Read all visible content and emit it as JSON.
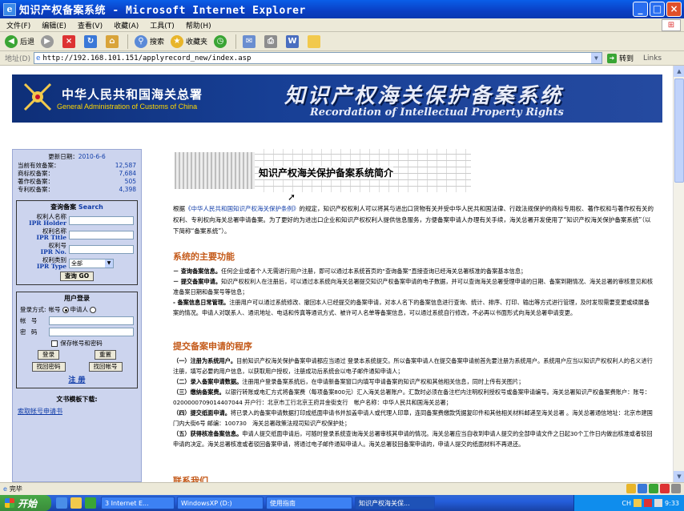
{
  "window": {
    "title": "知识产权备案系统 - Microsoft Internet Explorer"
  },
  "menu": [
    "文件(F)",
    "编辑(E)",
    "查看(V)",
    "收藏(A)",
    "工具(T)",
    "帮助(H)"
  ],
  "toolbar": {
    "back": "后退",
    "search": "搜索",
    "favorites": "收藏夹"
  },
  "address": {
    "label": "地址(D)",
    "url": "http://192.168.101.151/applyrecord_new/index.asp",
    "go": "转到",
    "links": "Links"
  },
  "banner": {
    "org_cn": "中华人民共和国海关总署",
    "org_en": "General Administration of Customs of China",
    "system_cn": "知识产权海关保护备案系统",
    "system_en": "Recordation of Intellectual Property Rights"
  },
  "stats": {
    "update_label": "更新日期：",
    "update_date": "2010-6-6",
    "rows": [
      {
        "label": "当前有效备案：",
        "value": "12,587"
      },
      {
        "label": "商标权备案：",
        "value": "7,684"
      },
      {
        "label": "著作权备案：",
        "value": "505"
      },
      {
        "label": "专利权备案：",
        "value": "4,398"
      }
    ]
  },
  "search": {
    "title_cn": "查询备案",
    "title_en": "Search",
    "holder_cn": "权利人名称",
    "holder_en": "IPR Holder",
    "title_field_cn": "权利名称",
    "title_field_en": "IPR Title",
    "no_cn": "权利号",
    "no_en": "IPR No.",
    "type_cn": "权利类别",
    "type_en": "IPR Type",
    "type_value": "全部",
    "button": "查询 GO"
  },
  "login": {
    "title": "用户登录",
    "mode_label": "登录方式:",
    "mode_account": "帐号",
    "mode_applicant": "申请人",
    "account_label": "帐 号",
    "password_label": "密 码",
    "remember": "保存帐号和密码",
    "login_btn": "登录",
    "reset_btn": "重置",
    "find_pwd": "找回密码",
    "find_acc": "找回帐号",
    "register": "注 册"
  },
  "downloads": {
    "title": "文书模板下载:",
    "link1": "索取帐号申请书"
  },
  "intro": {
    "image_title": "知识产权海关保护备案系统简介",
    "p1_pre": "根据",
    "p1_link": "《中华人民共和国知识产权海关保护条例》",
    "p1_post": "的规定，知识产权权利人可以将其与进出口货物有关并受中华人民共和国法律、行政法规保护的商标专用权、著作权和与著作权有关的权利、专利权向海关总署申请备案。为了更好的为进出口企业和知识产权权利人提供信息服务，方便备案申请人办理有关手续，海关总署开发使用了“知识产权海关保护备案系统”（以下简称“备案系统”）。"
  },
  "functions": {
    "heading": "系统的主要功能",
    "f1_title": "－ 查询备案信息。",
    "f1_text": "任何企业或者个人无需进行用户注册，即可以通过本系统首页的“查询备案”直接查询已经海关总署核准的备案基本信息；",
    "f2_title": "－ 提交备案申请。",
    "f2_text": "知识产权权利人在注册后，可以通过本系统向海关总署提交知识产权备案申请的电子数据，并可以查询海关总署受理申请的日期、备案到期情况、海关总署的审核意见和核准备案日期和备案号等信息；",
    "f3_title": "- 备案信息日常管理。",
    "f3_text": "注册用户可以通过系统修改、撤回本人已经提交的备案申请，对本人名下的备案信息进行查询、统计、排序、打印、输出等方式进行管理，及时发现需要变更或续展备案的情况。申请人对联系人、通讯地址、电话和传真等通讯方式、被许可人名单等备案信息，可以通过系统自行修改，不必再以书面形式向海关总署申请变更。"
  },
  "procedure": {
    "heading": "提交备案申请的程序",
    "s1_title": "（一）注册为系统用户。",
    "s1_text": "目前知识产权海关保护备案申请都应当通过 登录本系统提交。所以备案申请人在提交备案申请前首先要注册为系统用户。系统用户应当以知识产权权利人的名义进行注册，填写必要的用户信息，以获取用户授权，注册成功后系统会以电子邮件通知申请人；",
    "s2_title": "（二）录入备案申请数据。",
    "s2_text": "注册用户登录备案系统后，在申请新备案窗口内填写申请备案的知识产权和其他相关信息，同时上传有关图片；",
    "s3_title": "（三）缴纳备案费。",
    "s3_text": "以银行转账或电汇方式将备案费（每项备案800元）汇入海关总署账户。汇款时必须在备注栏内注明权利授权号或备案申请编号。海关总署知识产权备案费账户：账号：0200000709014407044 开户行：北京市工行北京王府井金街支行　帐户名称：中华人民共和国海关总署；",
    "s4_title": "（四）提交纸面申请。",
    "s4_text": "将已录入的备案申请数据打印成纸面申请书并加盖申请人或代理人印章，连同备案费缴款凭据复印件和其他相关材料邮递至海关总署 。海关总署通信地址：北京市建国门内大街6号 邮编：100730　海关总署政策法规司知识产权保护处；",
    "s5_title": "（五）获得核准备案信息。",
    "s5_text": "申请人提交纸面申请后，可随时登录系统查询海关总署审核其申请的情况。海关总署应当自收到申请人提交的全部申请文件之日起30个工作日内做出核准或者驳回申请的决定。海关总署核准或者驳回备案申请，将通过电子邮件通知申请人。海关总署驳回备案申请的，申请人提交的纸面材料不再退还。"
  },
  "contact": {
    "heading": "联系我们"
  },
  "status": {
    "text": "完毕"
  },
  "taskbar": {
    "start": "开始",
    "tasks": [
      "3 Internet E...",
      "WindowsXP (D:)",
      "使用指南",
      "知识产权海关保..."
    ],
    "clock": "9:33",
    "lang": "CH"
  }
}
